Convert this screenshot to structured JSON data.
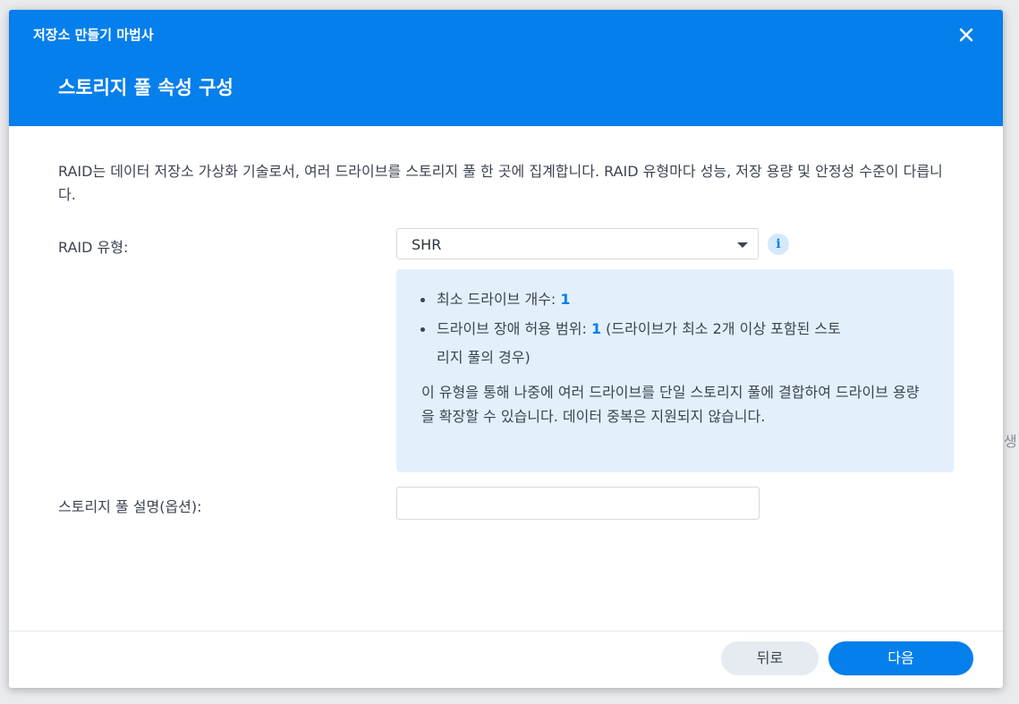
{
  "edge_text": "생",
  "dialog": {
    "wizard_title": "저장소 만들기 마법사",
    "step_title": "스토리지 풀 속성 구성",
    "close_icon": "close-icon",
    "description": "RAID는 데이터 저장소 가상화 기술로서, 여러 드라이브를 스토리지 풀 한 곳에 집계합니다. RAID 유형마다 성능, 저장 용량 및 안정성 수준이 다릅니다.",
    "raid_type": {
      "label": "RAID 유형:",
      "selected": "SHR",
      "info_icon": "info-icon"
    },
    "info_box": {
      "min_drives_label": "최소 드라이브 개수: ",
      "min_drives_value": "1",
      "fault_tolerance_label": "드라이브 장애 허용 범위: ",
      "fault_tolerance_value": "1",
      "fault_tolerance_note_line1": " (드라이브가 최소 2개 이상 포함된 스토",
      "fault_tolerance_note_line2": "리지 풀의 경우)",
      "paragraph": "이 유형을 통해 나중에 여러 드라이브를 단일 스토리지 풀에 결합하여 드라이브 용량을 확장할 수 있습니다. 데이터 중복은 지원되지 않습니다."
    },
    "pool_description": {
      "label": "스토리지 풀 설명(옵션):",
      "value": "",
      "placeholder": ""
    },
    "buttons": {
      "back": "뒤로",
      "next": "다음"
    },
    "colors": {
      "header": "#057feb",
      "accent": "#057feb",
      "info_box": "#e3f0fc"
    }
  }
}
